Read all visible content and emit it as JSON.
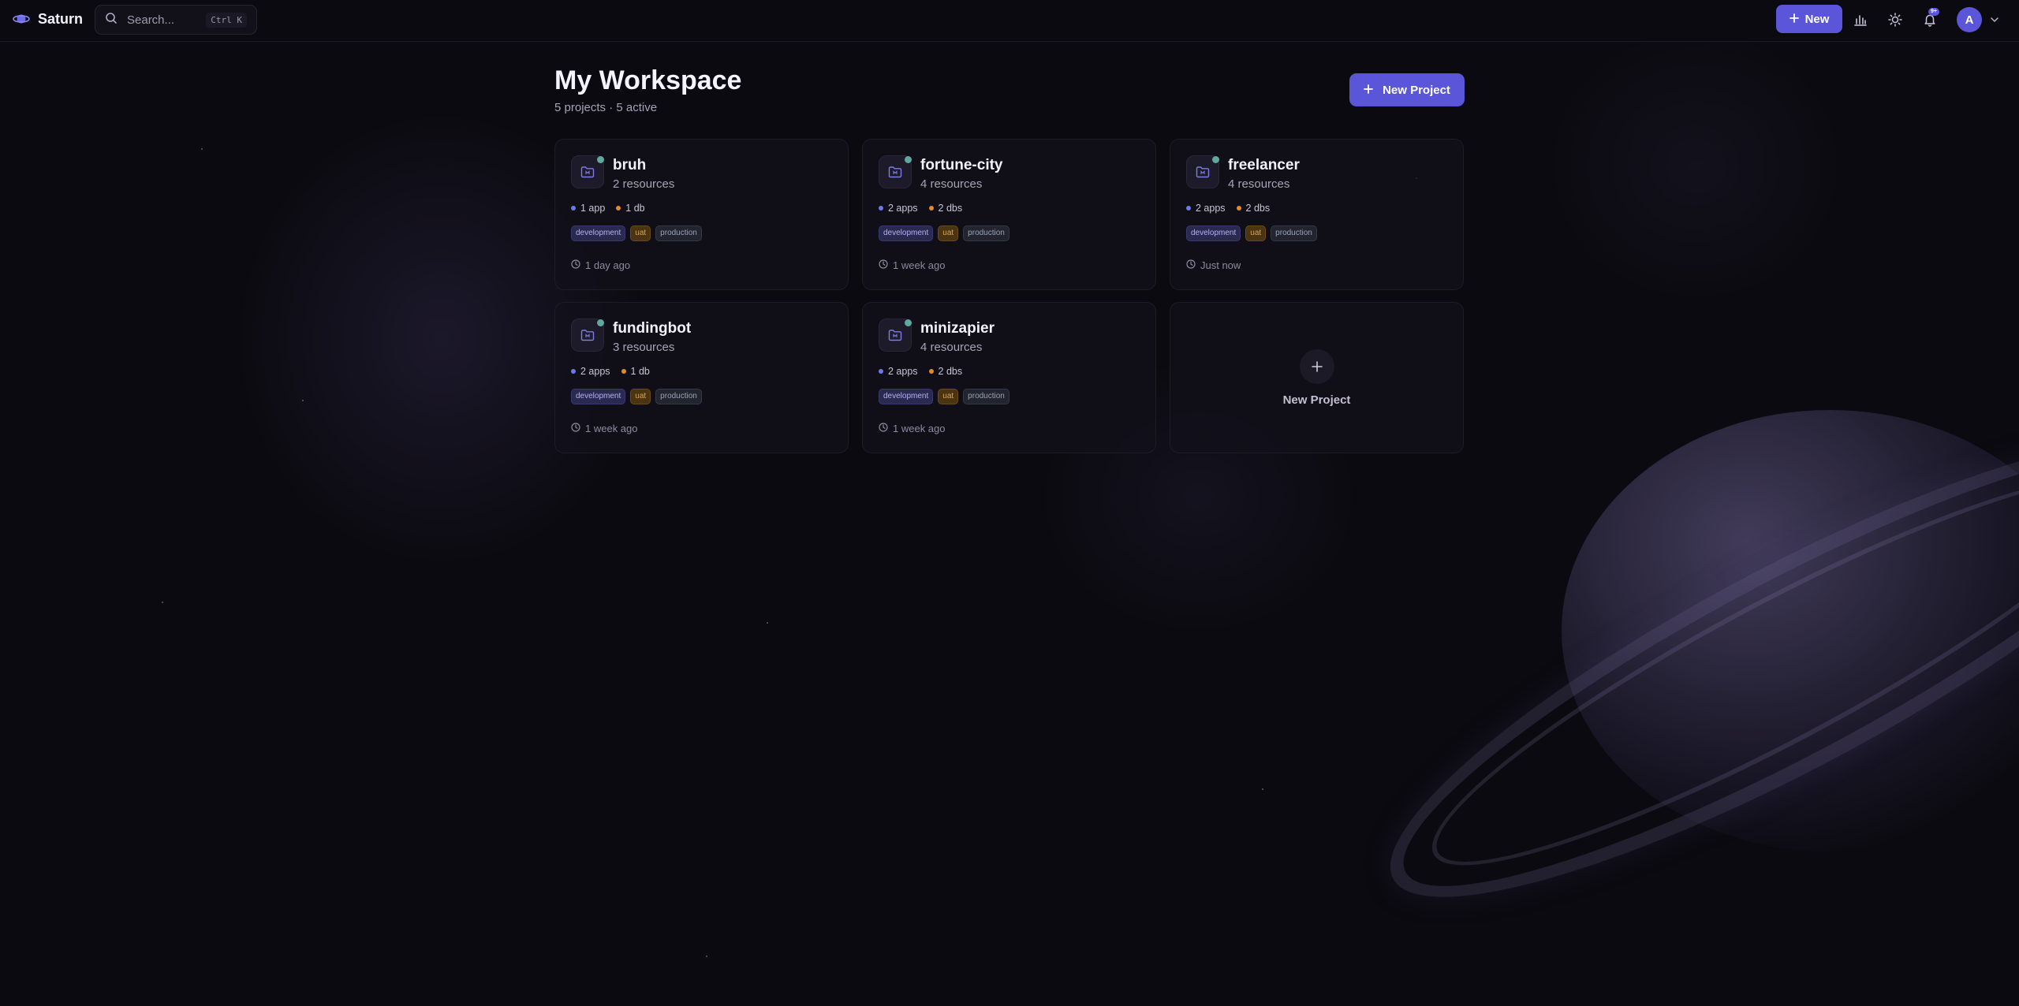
{
  "brand": {
    "name": "Saturn",
    "icon": "saturn-logo-icon"
  },
  "search": {
    "placeholder": "Search...",
    "shortcut": "Ctrl K",
    "icon": "search-icon"
  },
  "topbar": {
    "new_label": "New",
    "notification_badge": "9+",
    "avatar_initial": "A",
    "icons": [
      "bar-chart-icon",
      "sun-icon",
      "bell-icon",
      "chevron-down-icon"
    ]
  },
  "page": {
    "title": "My Workspace",
    "subtitle": "5 projects · 5 active",
    "new_project_label": "New Project"
  },
  "colors": {
    "accent": "#5b56d9",
    "app_dot": "#6b7ae8",
    "db_dot": "#e08a2a",
    "status": "#5fa8a0"
  },
  "projects": [
    {
      "name": "bruh",
      "resources": "2 resources",
      "apps": "1 app",
      "dbs": "1 db",
      "tags": [
        "development",
        "uat",
        "production"
      ],
      "updated": "1 day ago"
    },
    {
      "name": "fortune-city",
      "resources": "4 resources",
      "apps": "2 apps",
      "dbs": "2 dbs",
      "tags": [
        "development",
        "uat",
        "production"
      ],
      "updated": "1 week ago"
    },
    {
      "name": "freelancer",
      "resources": "4 resources",
      "apps": "2 apps",
      "dbs": "2 dbs",
      "tags": [
        "development",
        "uat",
        "production"
      ],
      "updated": "Just now"
    },
    {
      "name": "fundingbot",
      "resources": "3 resources",
      "apps": "2 apps",
      "dbs": "1 db",
      "tags": [
        "development",
        "uat",
        "production"
      ],
      "updated": "1 week ago"
    },
    {
      "name": "minizapier",
      "resources": "4 resources",
      "apps": "2 apps",
      "dbs": "2 dbs",
      "tags": [
        "development",
        "uat",
        "production"
      ],
      "updated": "1 week ago"
    }
  ],
  "add_card": {
    "label": "New Project"
  }
}
